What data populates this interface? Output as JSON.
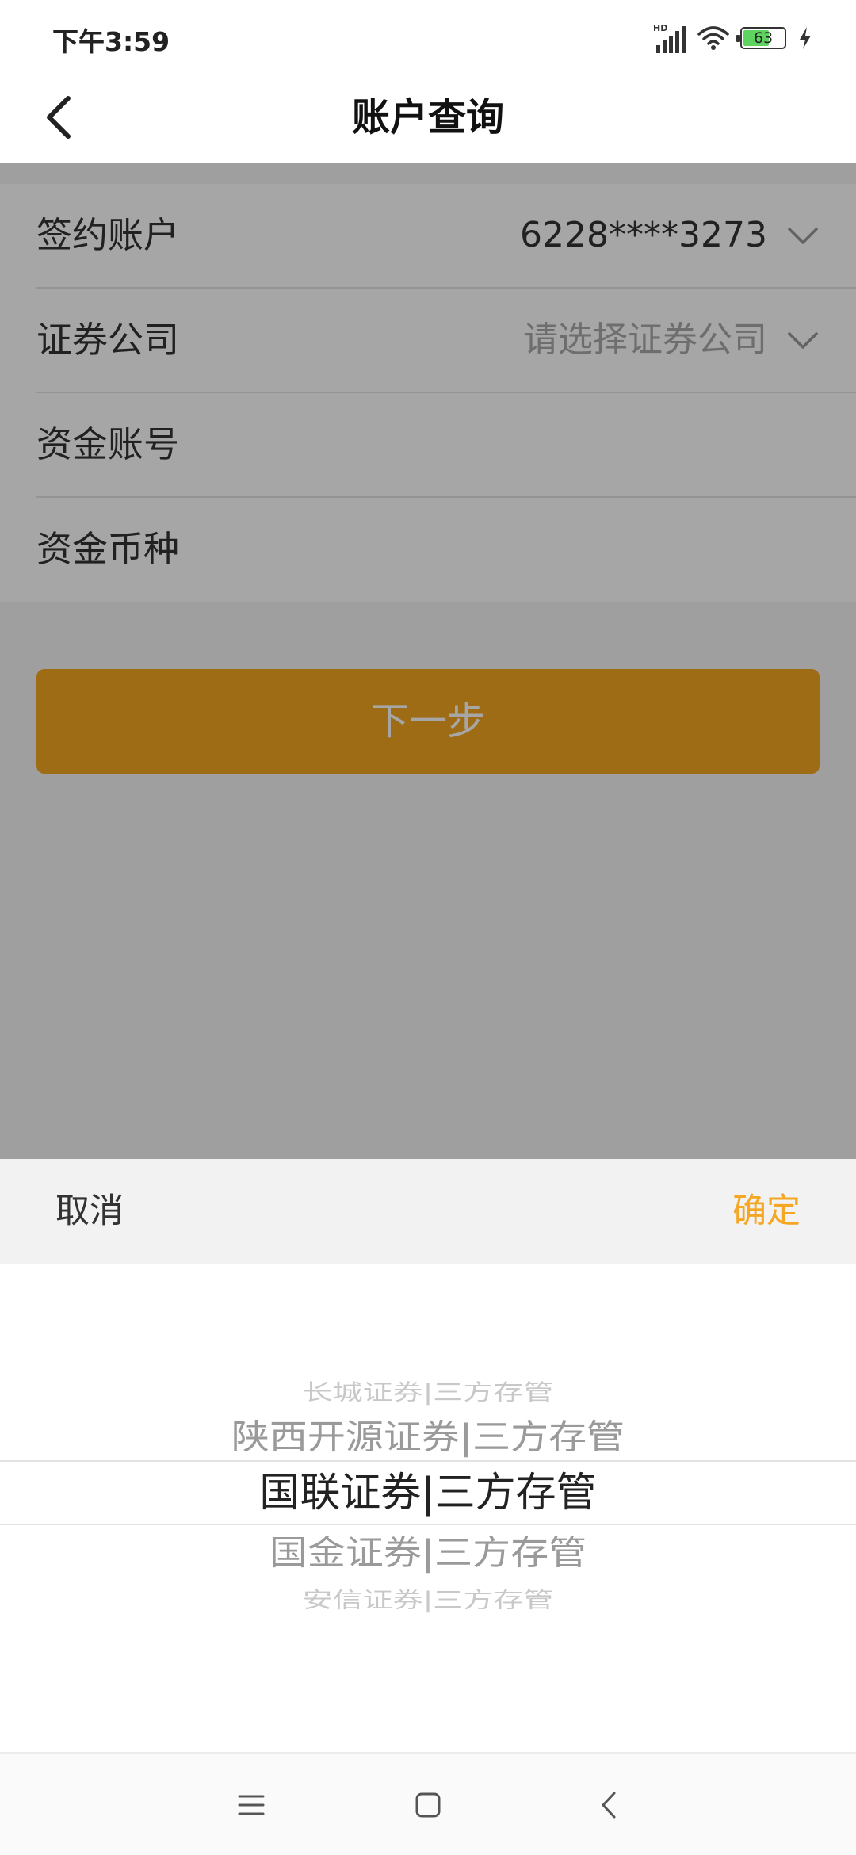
{
  "status_bar": {
    "time": "下午3:59",
    "network_label": "HD",
    "battery_level": "63",
    "battery_fraction": 0.63,
    "icons": [
      "hd-signal-icon",
      "wifi-icon",
      "battery-icon",
      "charging-icon"
    ]
  },
  "header": {
    "title": "账户查询",
    "back_icon": "chevron-left-icon"
  },
  "form": {
    "rows": [
      {
        "label": "签约账户",
        "value": "6228****3273",
        "placeholder": false,
        "has_dropdown": true
      },
      {
        "label": "证券公司",
        "value": "请选择证券公司",
        "placeholder": true,
        "has_dropdown": true
      },
      {
        "label": "资金账号",
        "value": "",
        "placeholder": false,
        "has_dropdown": false
      },
      {
        "label": "资金币种",
        "value": "",
        "placeholder": false,
        "has_dropdown": false
      }
    ],
    "dropdown_icon": "chevron-down-icon"
  },
  "next_button": {
    "label": "下一步"
  },
  "picker": {
    "cancel_label": "取消",
    "confirm_label": "确定",
    "options": [
      "长城证券|三方存管",
      "陕西开源证券|三方存管",
      "国联证券|三方存管",
      "国金证券|三方存管",
      "安信证券|三方存管"
    ],
    "selected_index": 2
  },
  "nav_bar": {
    "icons": [
      "menu-icon",
      "home-icon",
      "back-icon"
    ]
  },
  "colors": {
    "accent": "#f5a623",
    "overlay": "rgba(0,0,0,0.35)",
    "text_primary": "#333333",
    "placeholder": "#aaaaaa"
  }
}
